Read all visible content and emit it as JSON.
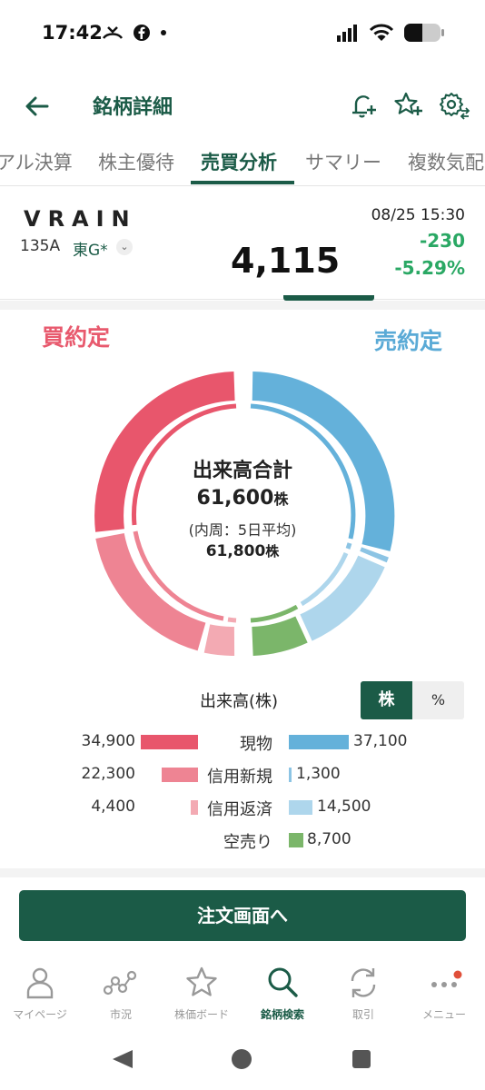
{
  "status": {
    "time": "17:42"
  },
  "header": {
    "title": "銘柄詳細"
  },
  "tabs": [
    {
      "label": "アル決算"
    },
    {
      "label": "株主優待"
    },
    {
      "label": "売買分析"
    },
    {
      "label": "サマリー"
    },
    {
      "label": "複数気配"
    }
  ],
  "stock": {
    "name": "VRAIN",
    "code": "135A",
    "market": "東G*",
    "price": "4,115",
    "datetime": "08/25 15:30",
    "change": "-230",
    "change_pct": "-5.29%"
  },
  "analysis": {
    "buy_label": "買約定",
    "sell_label": "売約定",
    "center_title": "出来高合計",
    "total_value": "61,600",
    "total_unit": "株",
    "avg_caption": "(内周：5日平均)",
    "avg_value": "61,800",
    "avg_unit": "株",
    "volume_label": "出来高(株)",
    "toggle_stock": "株",
    "toggle_pct": "%"
  },
  "legend": [
    {
      "label": "現物",
      "left_value": "34,900",
      "right_value": "37,100"
    },
    {
      "label": "信用新規",
      "left_value": "22,300",
      "right_value": "1,300"
    },
    {
      "label": "信用返済",
      "left_value": "4,400",
      "right_value": "14,500"
    },
    {
      "label": "空売り",
      "left_value": "",
      "right_value": "8,700"
    }
  ],
  "order_button": "注文画面へ",
  "nav": [
    {
      "label": "マイページ",
      "icon": "person-icon"
    },
    {
      "label": "市況",
      "icon": "market-chart-icon"
    },
    {
      "label": "株価ボード",
      "icon": "star-icon"
    },
    {
      "label": "銘柄検索",
      "icon": "search-icon"
    },
    {
      "label": "取引",
      "icon": "refresh-icon"
    },
    {
      "label": "メニュー",
      "icon": "more-icon"
    }
  ],
  "colors": {
    "brand": "#1b5b47",
    "buy_cash": "#e8566c",
    "buy_margin_new": "#ee8493",
    "buy_margin_close": "#f3aab3",
    "sell_cash": "#64b1da",
    "sell_margin_new": "#8cc4e4",
    "sell_margin_close": "#aed6ec",
    "short_sell": "#7bb66a",
    "up_down": "#2aa864"
  }
}
